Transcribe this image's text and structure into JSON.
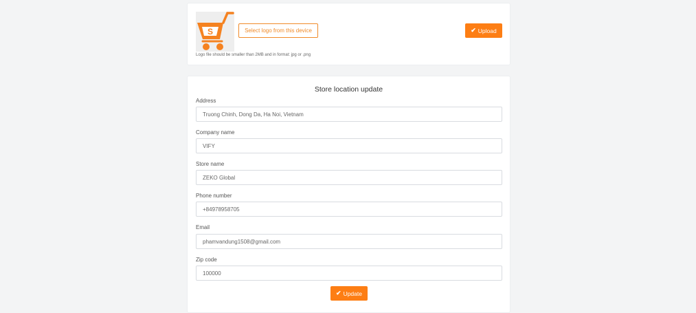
{
  "logo_section": {
    "select_label": "Select logo from this device",
    "hint": "Logo file should be smaller than 2MB and in format: jpg or .png",
    "upload_label": "Upload",
    "logo_icon": "shopping-cart-icon",
    "logo_letter": "S"
  },
  "form": {
    "title": "Store location update",
    "fields": [
      {
        "label": "Address",
        "value": "Truong Chinh, Dong Da, Ha Noi, Vietnam"
      },
      {
        "label": "Company name",
        "value": "VIFY"
      },
      {
        "label": "Store name",
        "value": "ZEKO Global"
      },
      {
        "label": "Phone number",
        "value": "+84978958705"
      },
      {
        "label": "Email",
        "value": "phamvandung1508@gmail.com"
      },
      {
        "label": "Zip code",
        "value": "100000"
      }
    ],
    "update_label": "Update"
  },
  "colors": {
    "accent": "#fd7e14",
    "background": "#f3f4f5",
    "card": "#ffffff"
  },
  "icons": {
    "check": "✔"
  }
}
